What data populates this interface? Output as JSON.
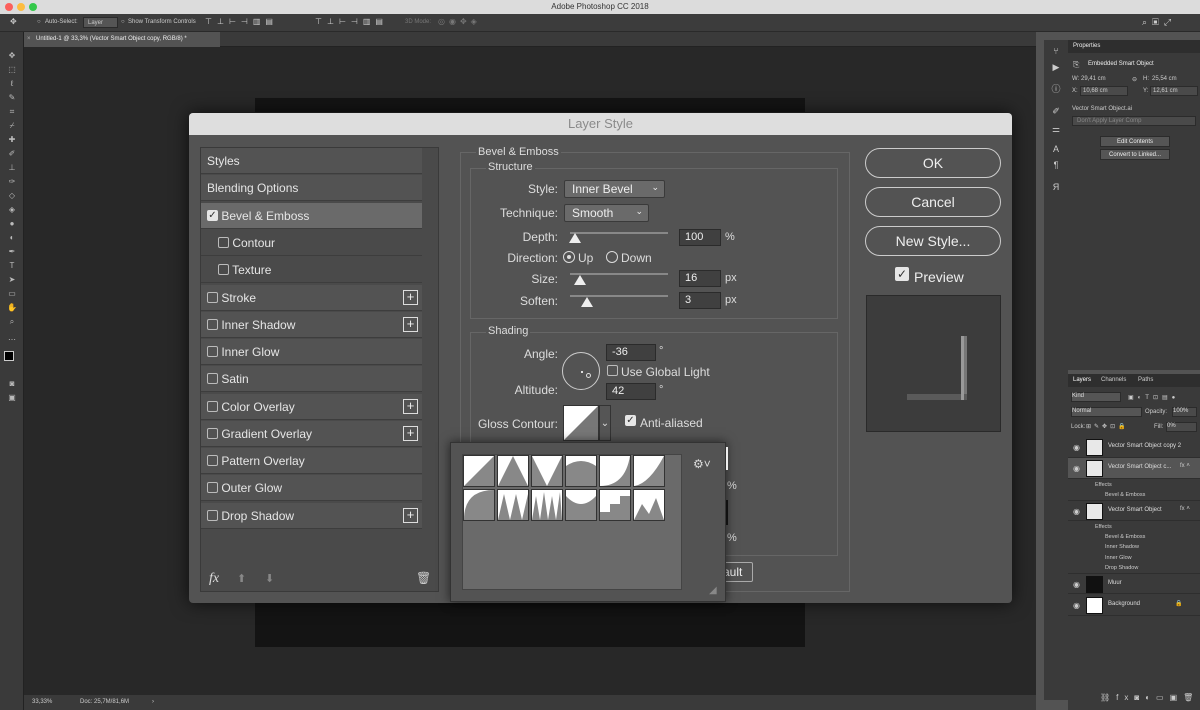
{
  "app": {
    "title": "Adobe Photoshop CC 2018"
  },
  "options_bar": {
    "auto_select": "Auto-Select:",
    "layer_select": "Layer",
    "transform_controls": "Show Transform Controls",
    "mode_3d": "3D Mode:"
  },
  "document": {
    "tab": "Untitled-1 @ 33,3% (Vector Smart Object copy, RGB/8) *"
  },
  "status": {
    "zoom": "33,33%",
    "doc": "Doc: 25,7M/81,6M"
  },
  "properties": {
    "header": "Properties",
    "kind": "Embedded Smart Object",
    "w_label": "W:",
    "w": "29,41 cm",
    "h_label": "H:",
    "h": "25,54 cm",
    "x_label": "X:",
    "x": "10,68 cm",
    "y_label": "Y:",
    "y": "12,61 cm",
    "file": "Vector Smart Object.ai",
    "comp": "Don't Apply Layer Comp",
    "edit": "Edit Contents",
    "convert": "Convert to Linked..."
  },
  "layers_panel": {
    "tabs": [
      "Layers",
      "Channels",
      "Paths"
    ],
    "kind": "Kind",
    "blend": "Normal",
    "opacity_label": "Opacity:",
    "opacity": "100%",
    "lock_label": "Lock:",
    "fill_label": "Fill:",
    "fill": "0%",
    "layers": [
      {
        "name": "Vector Smart Object copy 2"
      },
      {
        "name": "Vector Smart Object c..."
      },
      {
        "name": "Vector Smart Object"
      },
      {
        "name": "Muur"
      },
      {
        "name": "Background"
      }
    ],
    "effects_label": "Effects",
    "fx1": [
      "Bevel & Emboss"
    ],
    "fx2": [
      "Bevel & Emboss",
      "Inner Shadow",
      "Inner Glow",
      "Drop Shadow"
    ]
  },
  "dialog": {
    "title": "Layer Style",
    "styles": [
      "Styles",
      "Blending Options",
      "Bevel & Emboss",
      "Contour",
      "Texture",
      "Stroke",
      "Inner Shadow",
      "Inner Glow",
      "Satin",
      "Color Overlay",
      "Gradient Overlay",
      "Pattern Overlay",
      "Outer Glow",
      "Drop Shadow"
    ],
    "fx_label": "fx",
    "section": "Bevel & Emboss",
    "structure": "Structure",
    "style_label": "Style:",
    "style_value": "Inner Bevel",
    "technique_label": "Technique:",
    "technique_value": "Smooth",
    "depth_label": "Depth:",
    "depth": "100",
    "depth_unit": "%",
    "direction_label": "Direction:",
    "up": "Up",
    "down": "Down",
    "size_label": "Size:",
    "size": "16",
    "size_unit": "px",
    "soften_label": "Soften:",
    "soften": "3",
    "soften_unit": "px",
    "shading": "Shading",
    "angle_label": "Angle:",
    "angle": "-36",
    "deg": "°",
    "global_light": "Use Global Light",
    "altitude_label": "Altitude:",
    "altitude": "42",
    "gloss_label": "Gloss Contour:",
    "antialiased": "Anti-aliased",
    "pct1": "%",
    "pct2": "%",
    "default_btn": "ault",
    "ok": "OK",
    "cancel": "Cancel",
    "new_style": "New Style...",
    "preview": "Preview",
    "depth_level": 0.05,
    "size_level": 0.1,
    "soften_level": 0.17
  }
}
